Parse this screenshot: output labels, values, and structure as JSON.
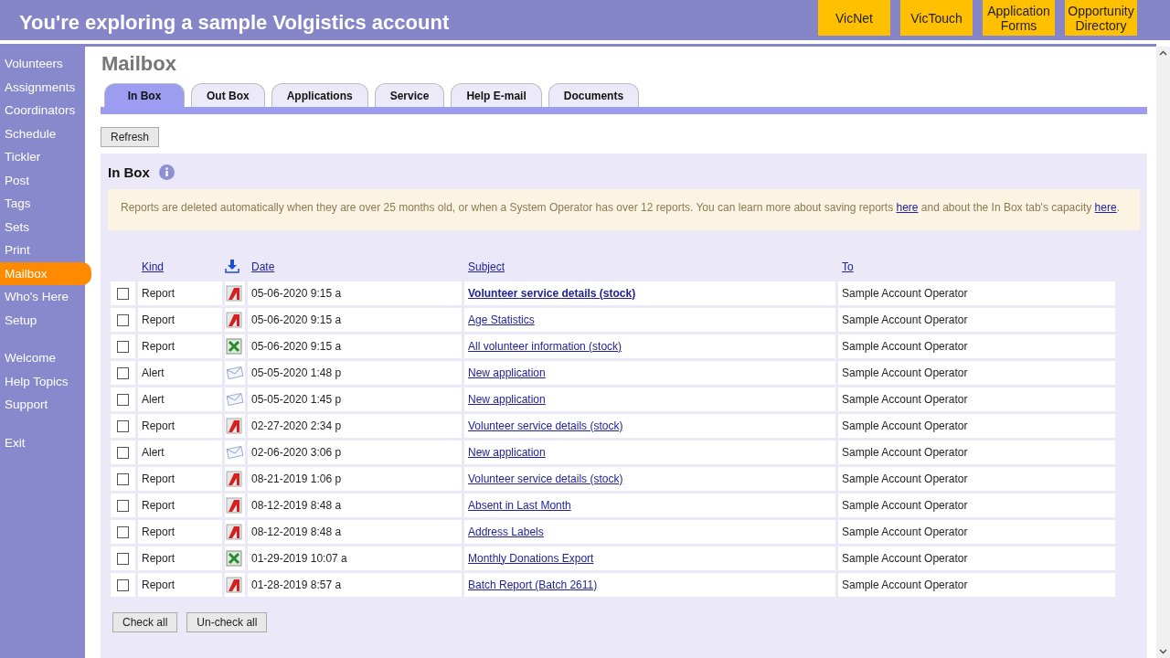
{
  "banner": {
    "title": "You're exploring a sample Volgistics account",
    "links": [
      "VicNet",
      "VicTouch",
      "Application Forms",
      "Opportunity Directory"
    ]
  },
  "sidebar": {
    "groups": [
      [
        {
          "label": "Volunteers",
          "selected": false
        },
        {
          "label": "Assignments",
          "selected": false
        },
        {
          "label": "Coordinators",
          "selected": false
        },
        {
          "label": "Schedule",
          "selected": false
        },
        {
          "label": "Tickler",
          "selected": false
        },
        {
          "label": "Post",
          "selected": false
        },
        {
          "label": "Tags",
          "selected": false
        },
        {
          "label": "Sets",
          "selected": false
        },
        {
          "label": "Print",
          "selected": false
        },
        {
          "label": "Mailbox",
          "selected": true
        },
        {
          "label": "Who's Here",
          "selected": false
        },
        {
          "label": "Setup",
          "selected": false
        }
      ],
      [
        {
          "label": "Welcome",
          "selected": false
        },
        {
          "label": "Help Topics",
          "selected": false
        },
        {
          "label": "Support",
          "selected": false
        }
      ],
      [
        {
          "label": "Exit",
          "selected": false
        }
      ]
    ]
  },
  "page_title": "Mailbox",
  "tabs": [
    {
      "label": "In Box",
      "selected": true
    },
    {
      "label": "Out Box",
      "selected": false
    },
    {
      "label": "Applications",
      "selected": false
    },
    {
      "label": "Service",
      "selected": false
    },
    {
      "label": "Help E-mail",
      "selected": false
    },
    {
      "label": "Documents",
      "selected": false
    }
  ],
  "refresh_button": "Refresh",
  "section_title": "In Box",
  "notice": {
    "parts": [
      {
        "kind": "text",
        "text": "Reports are deleted automatically when they are over 25 months old, or when a System Operator has over 12 reports. You can learn more about saving reports "
      },
      {
        "kind": "link",
        "text": "here"
      },
      {
        "kind": "text",
        "text": " and about the In Box tab's capacity "
      },
      {
        "kind": "link",
        "text": "here"
      },
      {
        "kind": "text",
        "text": "."
      }
    ]
  },
  "table": {
    "columns": [
      "Kind",
      "Date",
      "Subject",
      "To"
    ],
    "rows": [
      {
        "checked": false,
        "category": "Report",
        "kind": "pdf",
        "date": "05-06-2020 9:15 a",
        "subject": "Volunteer service details (stock)",
        "unread": true,
        "to": "Sample Account Operator"
      },
      {
        "checked": false,
        "category": "Report",
        "kind": "pdf",
        "date": "05-06-2020 9:15 a",
        "subject": "Age Statistics",
        "unread": false,
        "to": "Sample Account Operator"
      },
      {
        "checked": false,
        "category": "Report",
        "kind": "excel",
        "date": "05-06-2020 9:15 a",
        "subject": "All volunteer information (stock)",
        "unread": false,
        "to": "Sample Account Operator"
      },
      {
        "checked": false,
        "category": "Alert",
        "kind": "mail",
        "date": "05-05-2020 1:48 p",
        "subject": "New application",
        "unread": false,
        "to": "Sample Account Operator"
      },
      {
        "checked": false,
        "category": "Alert",
        "kind": "mail",
        "date": "05-05-2020 1:45 p",
        "subject": "New application",
        "unread": false,
        "to": "Sample Account Operator"
      },
      {
        "checked": false,
        "category": "Report",
        "kind": "pdf",
        "date": "02-27-2020 2:34 p",
        "subject": "Volunteer service details (stock)",
        "unread": false,
        "to": "Sample Account Operator"
      },
      {
        "checked": false,
        "category": "Alert",
        "kind": "mail",
        "date": "02-06-2020 3:06 p",
        "subject": "New application",
        "unread": false,
        "to": "Sample Account Operator"
      },
      {
        "checked": false,
        "category": "Report",
        "kind": "pdf",
        "date": "08-21-2019 1:06 p",
        "subject": "Volunteer service details (stock)",
        "unread": false,
        "to": "Sample Account Operator"
      },
      {
        "checked": false,
        "category": "Report",
        "kind": "pdf",
        "date": "08-12-2019 8:48 a",
        "subject": "Absent in Last Month",
        "unread": false,
        "to": "Sample Account Operator"
      },
      {
        "checked": false,
        "category": "Report",
        "kind": "pdf",
        "date": "08-12-2019 8:48 a",
        "subject": "Address Labels",
        "unread": false,
        "to": "Sample Account Operator"
      },
      {
        "checked": false,
        "category": "Report",
        "kind": "excel",
        "date": "01-29-2019 10:07 a",
        "subject": "Monthly Donations Export",
        "unread": false,
        "to": "Sample Account Operator"
      },
      {
        "checked": false,
        "category": "Report",
        "kind": "pdf",
        "date": "01-28-2019 8:57 a",
        "subject": "Batch Report (Batch 2611)",
        "unread": false,
        "to": "Sample Account Operator"
      }
    ]
  },
  "footer_buttons": [
    "Check all",
    "Un-check all"
  ]
}
